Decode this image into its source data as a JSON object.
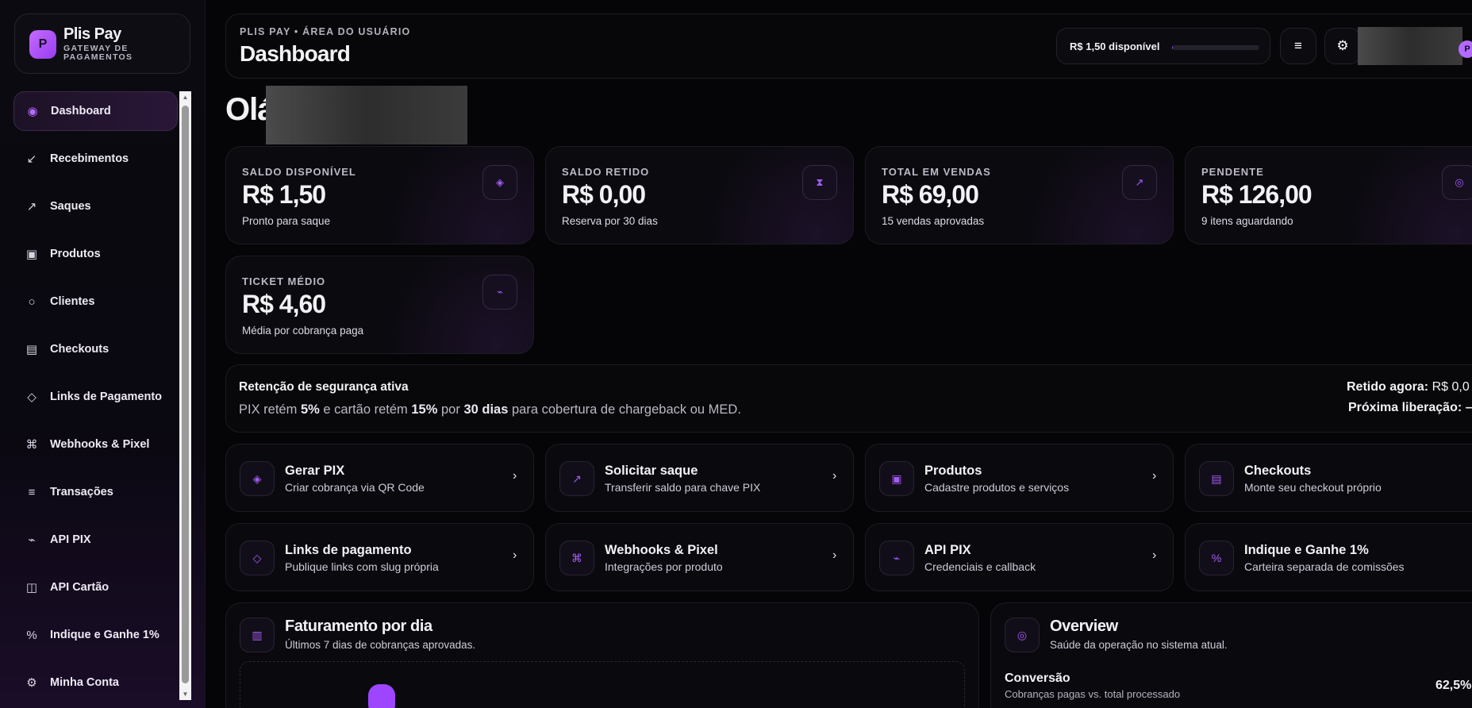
{
  "brand": {
    "logo_letter": "P",
    "name": "Plis Pay",
    "subtitle": "GATEWAY DE PAGAMENTOS"
  },
  "sidebar": {
    "items": [
      {
        "label": "Dashboard",
        "icon": "◉",
        "icon_name": "dashboard-dot-icon",
        "active": true
      },
      {
        "label": "Recebimentos",
        "icon": "↙",
        "icon_name": "arrow-in-icon"
      },
      {
        "label": "Saques",
        "icon": "↗",
        "icon_name": "arrow-out-icon"
      },
      {
        "label": "Produtos",
        "icon": "▣",
        "icon_name": "box-icon"
      },
      {
        "label": "Clientes",
        "icon": "○",
        "icon_name": "users-icon"
      },
      {
        "label": "Checkouts",
        "icon": "▤",
        "icon_name": "checkout-icon"
      },
      {
        "label": "Links de Pagamento",
        "icon": "◇",
        "icon_name": "link-icon"
      },
      {
        "label": "Webhooks & Pixel",
        "icon": "⌘",
        "icon_name": "webhook-icon"
      },
      {
        "label": "Transações",
        "icon": "≡",
        "icon_name": "list-icon"
      },
      {
        "label": "API PIX",
        "icon": "⌁",
        "icon_name": "api-icon"
      },
      {
        "label": "API Cartão",
        "icon": "◫",
        "icon_name": "card-icon"
      },
      {
        "label": "Indique e Ganhe 1%",
        "icon": "%",
        "icon_name": "percent-icon"
      },
      {
        "label": "Minha Conta",
        "icon": "⚙",
        "icon_name": "gear-icon"
      }
    ]
  },
  "topbar": {
    "breadcrumb": "PLIS PAY • ÁREA DO USUÁRIO",
    "title": "Dashboard",
    "balance_label": "R$ 1,50 disponível",
    "balance_fraction": 0.01,
    "menu_icon": "≡",
    "settings_icon": "⚙",
    "avatar_letter": "P"
  },
  "greeting": "Olá",
  "stats": [
    {
      "label": "SALDO DISPONÍVEL",
      "value": "R$ 1,50",
      "sub": "Pronto para saque",
      "icon": "◈",
      "icon_name": "wallet-icon"
    },
    {
      "label": "SALDO RETIDO",
      "value": "R$ 0,00",
      "sub": "Reserva por 30 dias",
      "icon": "⧗",
      "icon_name": "hourglass-icon"
    },
    {
      "label": "TOTAL EM VENDAS",
      "value": "R$ 69,00",
      "sub": "15 vendas aprovadas",
      "icon": "↗",
      "icon_name": "trend-up-icon"
    },
    {
      "label": "PENDENTE",
      "value": "R$ 126,00",
      "sub": "9 itens aguardando",
      "icon": "◎",
      "icon_name": "clock-icon"
    },
    {
      "label": "TICKET MÉDIO",
      "value": "R$ 4,60",
      "sub": "Média por cobrança paga",
      "icon": "⌁",
      "icon_name": "pulse-icon"
    }
  ],
  "retention": {
    "title": "Retenção de segurança ativa",
    "text_1": "PIX retém ",
    "pix_pct": "5%",
    "text_2": " e cartão retém ",
    "card_pct": "15%",
    "text_3": " por ",
    "days": "30 dias",
    "text_4": " para cobertura de chargeback ou MED.",
    "held_label": "Retido agora:",
    "held_value": "R$ 0,0",
    "next_label": "Próxima liberação:",
    "next_value": "–"
  },
  "quick_actions": [
    {
      "title": "Gerar PIX",
      "sub": "Criar cobrança via QR Code",
      "icon": "◈",
      "icon_name": "pix-icon"
    },
    {
      "title": "Solicitar saque",
      "sub": "Transferir saldo para chave PIX",
      "icon": "↗",
      "icon_name": "withdraw-icon"
    },
    {
      "title": "Produtos",
      "sub": "Cadastre produtos e serviços",
      "icon": "▣",
      "icon_name": "box-icon"
    },
    {
      "title": "Checkouts",
      "sub": "Monte seu checkout próprio",
      "icon": "▤",
      "icon_name": "checkout-icon"
    },
    {
      "title": "Links de pagamento",
      "sub": "Publique links com slug própria",
      "icon": "◇",
      "icon_name": "link-icon"
    },
    {
      "title": "Webhooks & Pixel",
      "sub": "Integrações por produto",
      "icon": "⌘",
      "icon_name": "webhook-icon"
    },
    {
      "title": "API PIX",
      "sub": "Credenciais e callback",
      "icon": "⌁",
      "icon_name": "api-icon"
    },
    {
      "title": "Indique e Ganhe 1%",
      "sub": "Carteira separada de comissões",
      "icon": "%",
      "icon_name": "percent-icon"
    }
  ],
  "arrow": "›",
  "revenue_panel": {
    "title": "Faturamento por dia",
    "sub": "Últimos 7 dias de cobranças aprovadas.",
    "icon": "▥"
  },
  "overview_panel": {
    "title": "Overview",
    "sub": "Saúde da operação no sistema atual.",
    "icon": "◎",
    "metric_label": "Conversão",
    "metric_sub": "Cobranças pagas vs. total processado",
    "metric_value": "62,5%"
  },
  "colors": {
    "accent": "#9d45ff",
    "background": "#050507"
  }
}
